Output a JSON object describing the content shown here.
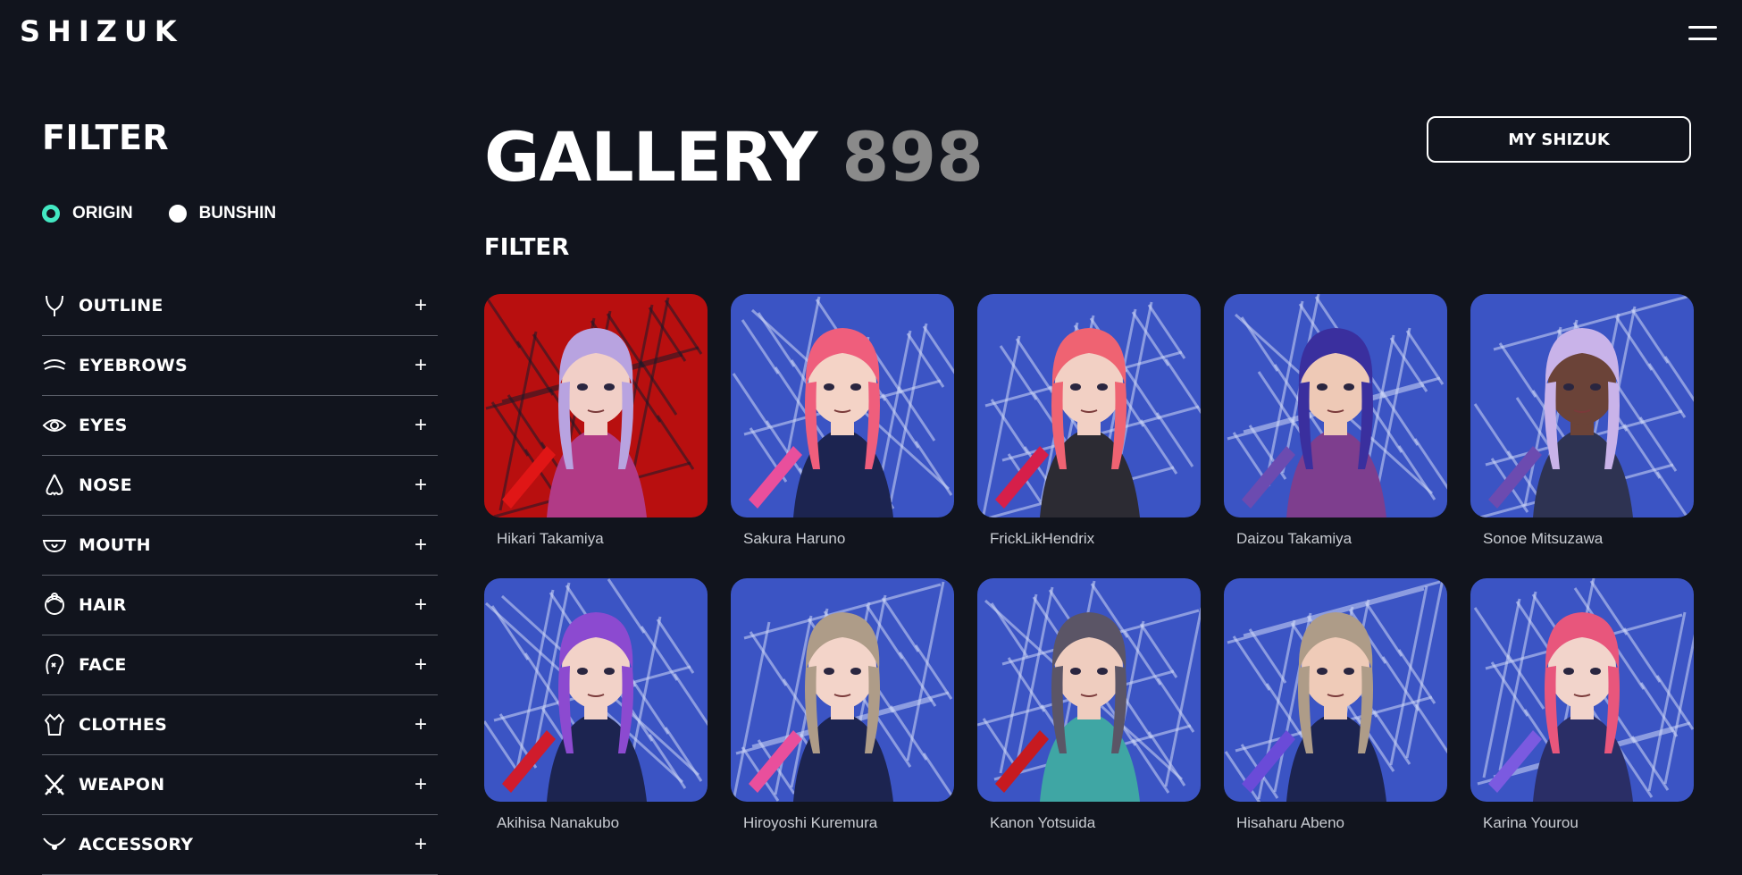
{
  "header": {
    "logo_text": "SHIZUK",
    "menu_icon": "hamburger-menu-icon"
  },
  "sidebar": {
    "title": "FILTER",
    "radios": [
      {
        "label": "ORIGIN",
        "selected": true
      },
      {
        "label": "BUNSHIN",
        "selected": false
      }
    ],
    "traits": [
      {
        "label": "OUTLINE",
        "icon": "outline-icon"
      },
      {
        "label": "EYEBROWS",
        "icon": "eyebrows-icon"
      },
      {
        "label": "EYES",
        "icon": "eye-icon"
      },
      {
        "label": "NOSE",
        "icon": "nose-icon"
      },
      {
        "label": "MOUTH",
        "icon": "mouth-icon"
      },
      {
        "label": "HAIR",
        "icon": "hair-icon"
      },
      {
        "label": "FACE",
        "icon": "face-icon"
      },
      {
        "label": "CLOTHES",
        "icon": "clothes-icon"
      },
      {
        "label": "WEAPON",
        "icon": "weapon-icon"
      },
      {
        "label": "ACCESSORY",
        "icon": "accessory-icon"
      }
    ],
    "expand_symbol": "+"
  },
  "main": {
    "title": "GALLERY",
    "count": "898",
    "my_button": "MY SHIZUK",
    "filter_label": "FILTER",
    "cards": [
      {
        "name": "Hikari Takamiya"
      },
      {
        "name": "Sakura Haruno"
      },
      {
        "name": "FrickLikHendrix"
      },
      {
        "name": "Daizou Takamiya"
      },
      {
        "name": "Sonoe Mitsuzawa"
      },
      {
        "name": "Akihisa Nanakubo"
      },
      {
        "name": "Hiroyoshi Kuremura"
      },
      {
        "name": "Kanon Yotsuida"
      },
      {
        "name": "Hisaharu Abeno"
      },
      {
        "name": "Karina Yourou"
      }
    ]
  },
  "colors": {
    "background": "#11141d",
    "accent": "#43e8c2",
    "count_gray": "#8a8a8a"
  }
}
